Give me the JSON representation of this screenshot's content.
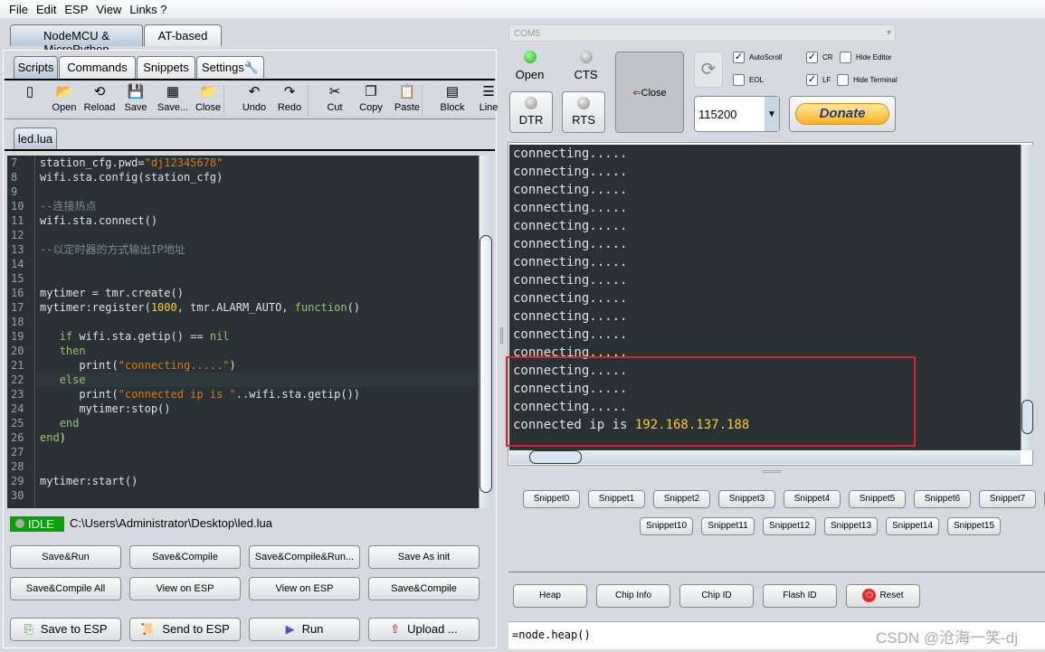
{
  "menu": [
    "File",
    "Edit",
    "ESP",
    "View",
    "Links ?"
  ],
  "main_tabs": [
    "NodeMCU & MicroPython",
    "AT-based"
  ],
  "sub_tabs": [
    "Scripts",
    "Commands",
    "Snippets",
    "Settings"
  ],
  "toolbar": [
    {
      "label": "",
      "icon": "new-file-icon"
    },
    {
      "label": "Open",
      "icon": "folder-open-icon"
    },
    {
      "label": "Reload",
      "icon": "reload-icon"
    },
    {
      "label": "Save",
      "icon": "save-icon"
    },
    {
      "label": "Save...",
      "icon": "save-as-icon"
    },
    {
      "label": "Close",
      "icon": "close-folder-icon"
    },
    {
      "label": "Undo",
      "icon": "undo-icon"
    },
    {
      "label": "Redo",
      "icon": "redo-icon"
    },
    {
      "label": "Cut",
      "icon": "cut-icon"
    },
    {
      "label": "Copy",
      "icon": "copy-icon"
    },
    {
      "label": "Paste",
      "icon": "paste-icon"
    },
    {
      "label": "Block",
      "icon": "block-icon"
    },
    {
      "label": "Line",
      "icon": "line-icon"
    }
  ],
  "file_tab": "led.lua",
  "code": {
    "line_numbers": [
      "7",
      "8",
      "9",
      "10",
      "11",
      "12",
      "13",
      "14",
      "15",
      "16",
      "17",
      "18",
      "19",
      "20",
      "21",
      "22",
      "23",
      "24",
      "25",
      "26",
      "27",
      "28",
      "29",
      "30"
    ],
    "lines": [
      [
        [
          "station_cfg.pwd=",
          ""
        ],
        [
          "\"dj12345678\"",
          "s"
        ]
      ],
      [
        [
          "wifi.sta.config(station_cfg)",
          ""
        ]
      ],
      [],
      [
        [
          "--连接热点",
          "c"
        ]
      ],
      [
        [
          "wifi.sta.connect()",
          ""
        ]
      ],
      [],
      [
        [
          "--以定时器的方式输出IP地址",
          "c"
        ]
      ],
      [],
      [],
      [
        [
          "mytimer = tmr.create()",
          ""
        ]
      ],
      [
        [
          "mytimer:register(",
          ""
        ],
        [
          "1000",
          "n"
        ],
        [
          ", tmr.ALARM_AUTO, ",
          ""
        ],
        [
          "function",
          "k"
        ],
        [
          "()",
          ""
        ]
      ],
      [],
      [
        [
          "   ",
          ""
        ],
        [
          "if",
          "k"
        ],
        [
          " wifi.sta.getip() == ",
          ""
        ],
        [
          "nil",
          "k"
        ]
      ],
      [
        [
          "   ",
          ""
        ],
        [
          "then",
          "k"
        ]
      ],
      [
        [
          "      print(",
          ""
        ],
        [
          "\"connecting.....\"",
          "s"
        ],
        [
          ")",
          ""
        ]
      ],
      [
        [
          "   ",
          ""
        ],
        [
          "else",
          "k"
        ]
      ],
      [
        [
          "      print(",
          ""
        ],
        [
          "\"connected ip is \"",
          "s"
        ],
        [
          "..wifi.sta.getip())",
          ""
        ]
      ],
      [
        [
          "      mytimer:stop()",
          ""
        ]
      ],
      [
        [
          "   ",
          ""
        ],
        [
          "end",
          "k"
        ]
      ],
      [
        [
          "end",
          "k"
        ],
        [
          ")",
          ""
        ]
      ],
      [],
      [],
      [
        [
          "mytimer:start()",
          ""
        ]
      ],
      []
    ]
  },
  "status": {
    "label": "IDLE",
    "path": "C:\\Users\\Administrator\\Desktop\\led.lua"
  },
  "buttons_row1": [
    "Save&Run",
    "Save&Compile",
    "Save&Compile&Run...",
    "Save As init"
  ],
  "buttons_row2": [
    "Save&Compile All",
    "View on ESP",
    "View on ESP",
    "Save&Compile"
  ],
  "buttons_row3": [
    {
      "label": "Save to ESP",
      "icon": "save-to-esp-icon"
    },
    {
      "label": "Send to ESP",
      "icon": "send-to-esp-icon"
    },
    {
      "label": "Run",
      "icon": "run-icon"
    },
    {
      "label": "Upload ...",
      "icon": "upload-icon"
    }
  ],
  "port": "COM5",
  "signals": {
    "open": "Open",
    "cts": "CTS",
    "dtr": "DTR",
    "rts": "RTS",
    "close": "Close"
  },
  "checkboxes": [
    {
      "label": "AutoScroll",
      "checked": true
    },
    {
      "label": "EOL",
      "checked": false
    },
    {
      "label": "CR",
      "checked": true
    },
    {
      "label": "LF",
      "checked": true
    },
    {
      "label": "Hide Editor",
      "checked": false
    },
    {
      "label": "Hide Terminal",
      "checked": false
    }
  ],
  "baud": "115200",
  "donate": "Donate",
  "terminal": {
    "lines": [
      "connecting.....",
      "connecting.....",
      "connecting.....",
      "connecting.....",
      "connecting.....",
      "connecting.....",
      "connecting.....",
      "connecting.....",
      "connecting.....",
      "connecting.....",
      "connecting.....",
      "connecting.....",
      "connecting.....",
      "connecting.....",
      "connecting....."
    ],
    "last_prefix": "connected ip is ",
    "last_ip": "192.168.137.188",
    "highlight_color": "#e0202a"
  },
  "snippets_row1": [
    "Snippet0",
    "Snippet1",
    "Snippet2",
    "Snippet3",
    "Snippet4",
    "Snippet5",
    "Snippet6",
    "Snippet7"
  ],
  "snippets_row2": [
    "Snippet10",
    "Snippet11",
    "Snippet12",
    "Snippet13",
    "Snippet14",
    "Snippet15"
  ],
  "commands": [
    "Heap",
    "Chip Info",
    "Chip ID",
    "Flash ID",
    "Reset"
  ],
  "command_input": "=node.heap()",
  "watermark": "CSDN @沧海一笑-dj",
  "colors": {
    "editor_bg": "#293134",
    "string": "#ec7600",
    "keyword": "#93c763",
    "number": "#ffcd22",
    "comment": "#7d8c93",
    "idle_green": "#0aa00a"
  }
}
